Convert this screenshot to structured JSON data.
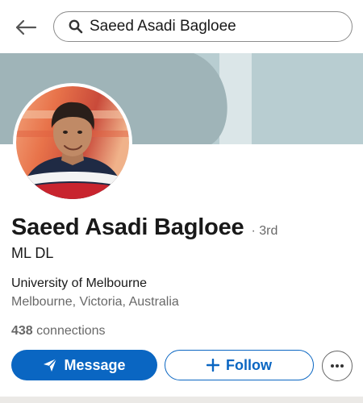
{
  "search": {
    "query": "Saeed Asadi Bagloee"
  },
  "profile": {
    "name": "Saeed Asadi Bagloee",
    "degree": "· 3rd",
    "headline": "ML DL",
    "school": "University of Melbourne",
    "location": "Melbourne, Victoria, Australia",
    "connections_count": "438",
    "connections_label": " connections"
  },
  "actions": {
    "message_label": "Message",
    "follow_label": "Follow"
  },
  "colors": {
    "brand_blue": "#0a66c2",
    "cover_dark": "#9fb4b8",
    "cover_light": "#b8cdd1"
  },
  "icons": [
    "back-arrow-icon",
    "search-icon",
    "send-icon",
    "plus-icon",
    "more-icon"
  ]
}
